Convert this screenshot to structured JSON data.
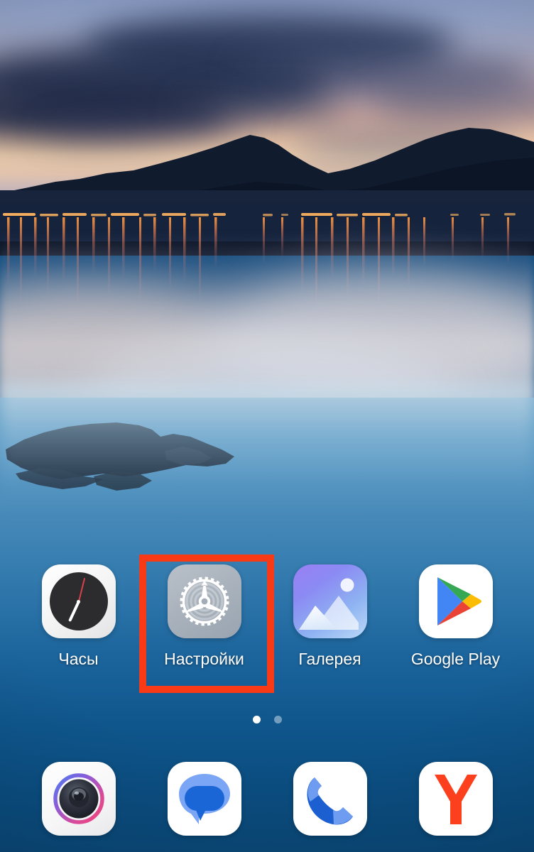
{
  "wallpaper": {
    "name": "dusk-lake-mountains-wallpaper",
    "description": "Twilight lake with mountain silhouette, city lights and misty reflections",
    "sky_top_color": "#8b9cc4",
    "sunset_glow_color": "#f0cfae",
    "lake_color": "#0c4d80",
    "city_light_color": "#ffb460"
  },
  "home_screen": {
    "apps": [
      {
        "label": "Часы",
        "icon": "clock-icon",
        "name": "app-clock"
      },
      {
        "label": "Настройки",
        "icon": "gear-icon",
        "name": "app-settings"
      },
      {
        "label": "Галерея",
        "icon": "image-icon",
        "name": "app-gallery"
      },
      {
        "label": "Google Play",
        "icon": "play-store-icon",
        "name": "app-google-play"
      }
    ],
    "page_indicator": {
      "total_pages": 2,
      "current_page": 1
    },
    "dock": [
      {
        "icon": "camera-icon",
        "name": "dock-camera"
      },
      {
        "icon": "messages-icon",
        "name": "dock-messages"
      },
      {
        "icon": "phone-icon",
        "name": "dock-phone"
      },
      {
        "icon": "yandex-browser-icon",
        "name": "dock-yandex"
      }
    ]
  },
  "annotation": {
    "type": "highlight-rectangle",
    "target_app": "Настройки",
    "color": "#f93a16",
    "border_width_px": 10
  }
}
